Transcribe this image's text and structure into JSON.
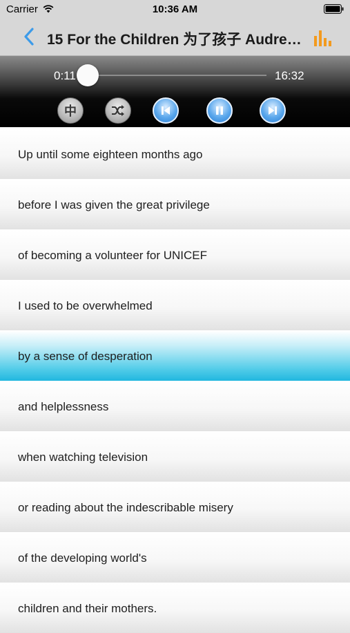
{
  "status_bar": {
    "carrier": "Carrier",
    "time": "10:36 AM",
    "icons": [
      "wifi-icon",
      "battery-icon"
    ]
  },
  "nav": {
    "back_icon": "chevron-left-icon",
    "title": "15 For the Children 为了孩子 Audrey...",
    "chart_icon": "bar-chart-icon",
    "accent_color": "#3d9be9",
    "chart_color": "#f39a1e"
  },
  "player": {
    "elapsed": "0:11",
    "total": "16:32",
    "progress_fraction": 0.011,
    "controls": {
      "language_label": "中",
      "shuffle_icon": "shuffle-icon",
      "previous_icon": "skip-previous-icon",
      "pause_icon": "pause-icon",
      "next_icon": "skip-next-icon"
    }
  },
  "lyrics": [
    {
      "text": "Up until some eighteen months ago",
      "active": false
    },
    {
      "text": "before I was given the great privilege",
      "active": false
    },
    {
      "text": "of becoming a volunteer for UNICEF",
      "active": false
    },
    {
      "text": "I used to be overwhelmed",
      "active": false
    },
    {
      "text": "by a sense of desperation",
      "active": true
    },
    {
      "text": "and helplessness",
      "active": false
    },
    {
      "text": "when watching television",
      "active": false
    },
    {
      "text": "or reading about the indescribable misery",
      "active": false
    },
    {
      "text": "of the developing world's",
      "active": false
    },
    {
      "text": "children and their mothers.",
      "active": false
    }
  ],
  "colors": {
    "highlight": "#21b7df",
    "player_bg": "#000000"
  }
}
